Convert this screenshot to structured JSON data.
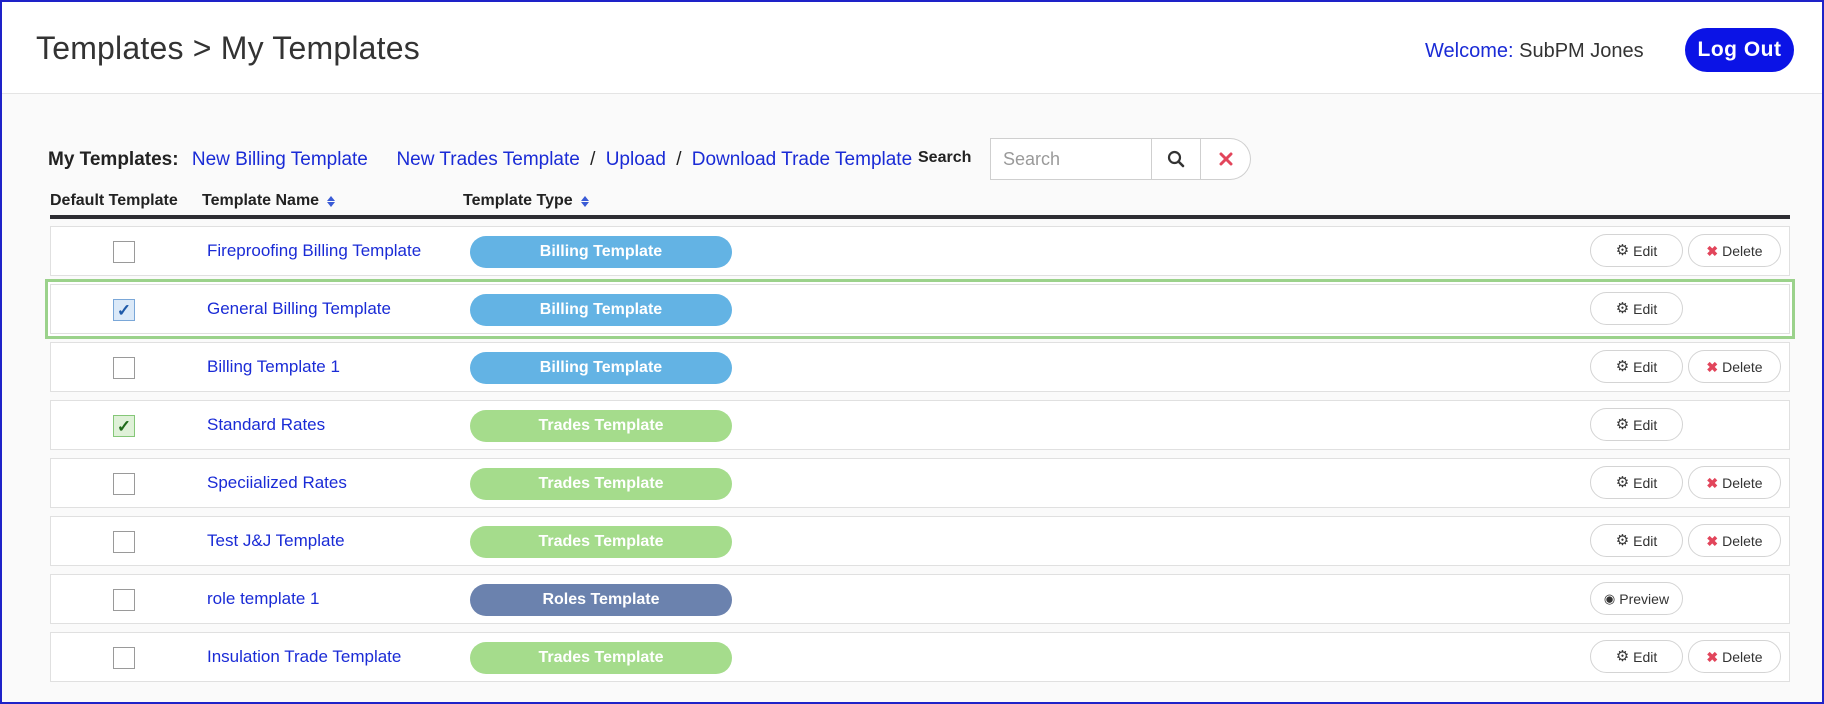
{
  "header": {
    "breadcrumb": "Templates > My Templates",
    "welcome_label": "Welcome:",
    "user_name": "SubPM Jones",
    "logout_label": "Log Out"
  },
  "toolbar": {
    "my_templates_label": "My Templates:",
    "new_billing_link": "New Billing Template",
    "new_trades_link": "New Trades Template",
    "separator": "/",
    "upload_link": "Upload",
    "download_trade_link": "Download Trade Template",
    "search_label": "Search",
    "search_placeholder": "Search"
  },
  "columns": {
    "default": "Default Template",
    "name": "Template Name",
    "type": "Template Type"
  },
  "action_labels": {
    "edit": "Edit",
    "delete": "Delete",
    "preview": "Preview"
  },
  "rows": [
    {
      "default": false,
      "name": "Fireproofing Billing Template",
      "type": "Billing Template",
      "actions": [
        "edit",
        "delete"
      ]
    },
    {
      "default": true,
      "name": "General Billing Template",
      "type": "Billing Template",
      "actions": [
        "edit"
      ],
      "highlighted": true
    },
    {
      "default": false,
      "name": "Billing Template 1",
      "type": "Billing Template",
      "actions": [
        "edit",
        "delete"
      ]
    },
    {
      "default": true,
      "name": "Standard Rates",
      "type": "Trades Template",
      "actions": [
        "edit"
      ]
    },
    {
      "default": false,
      "name": "Speciialized Rates",
      "type": "Trades Template",
      "actions": [
        "edit",
        "delete"
      ]
    },
    {
      "default": false,
      "name": "Test J&J Template",
      "type": "Trades Template",
      "actions": [
        "edit",
        "delete"
      ]
    },
    {
      "default": false,
      "name": "role template 1",
      "type": "Roles Template",
      "actions": [
        "preview"
      ]
    },
    {
      "default": false,
      "name": "Insulation Trade Template",
      "type": "Trades Template",
      "actions": [
        "edit",
        "delete"
      ]
    }
  ],
  "colors": {
    "billing_pill": "#63b3e4",
    "trades_pill": "#a5dc8c",
    "roles_pill": "#6b82ae",
    "link": "#1a2bd6",
    "logout_button": "#0b13e6",
    "highlight_border": "#9bd28b",
    "delete_icon": "#e2455b"
  },
  "icons": {
    "search": "search-icon",
    "clear": "clear-x-icon",
    "edit": "gear-icon",
    "delete": "x-icon",
    "preview": "eye-icon",
    "sort": "sort-icon"
  }
}
